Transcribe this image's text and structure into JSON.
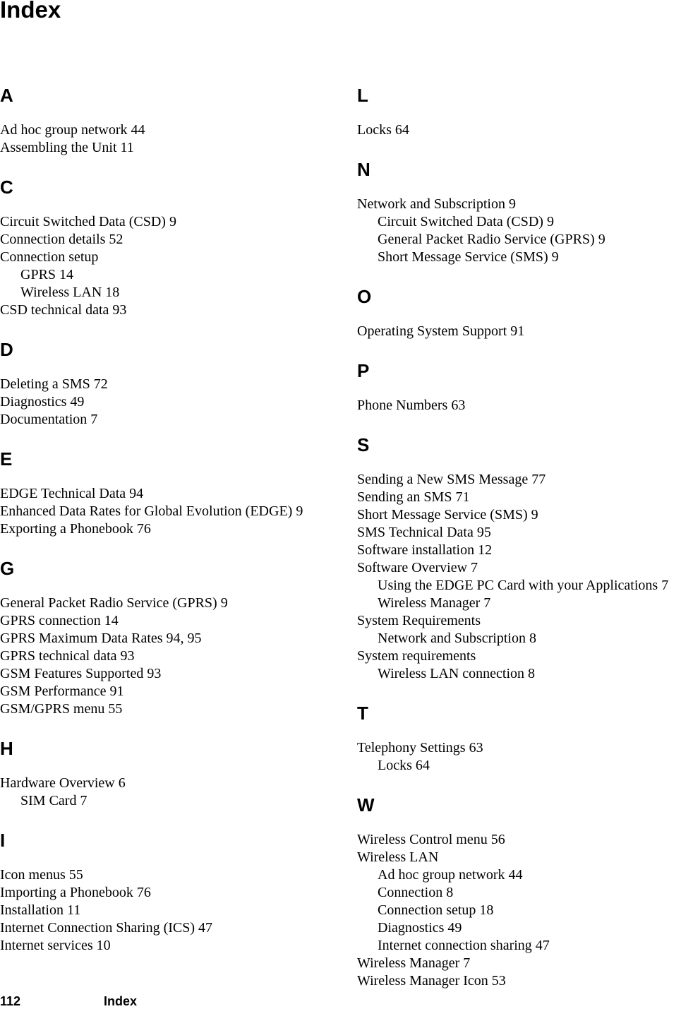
{
  "page": {
    "title": "Index",
    "footer": {
      "page_number": "112",
      "section": "Index"
    }
  },
  "columns": [
    {
      "sections": [
        {
          "letter": "A",
          "entries": [
            {
              "text": "Ad hoc group network 44",
              "level": 0
            },
            {
              "text": "Assembling the Unit 11",
              "level": 0
            }
          ]
        },
        {
          "letter": "C",
          "entries": [
            {
              "text": "Circuit Switched Data (CSD) 9",
              "level": 0
            },
            {
              "text": "Connection details 52",
              "level": 0
            },
            {
              "text": "Connection setup",
              "level": 0
            },
            {
              "text": "GPRS 14",
              "level": 1
            },
            {
              "text": "Wireless LAN 18",
              "level": 1
            },
            {
              "text": "CSD technical data 93",
              "level": 0
            }
          ]
        },
        {
          "letter": "D",
          "entries": [
            {
              "text": "Deleting a SMS 72",
              "level": 0
            },
            {
              "text": "Diagnostics 49",
              "level": 0
            },
            {
              "text": "Documentation 7",
              "level": 0
            }
          ]
        },
        {
          "letter": "E",
          "entries": [
            {
              "text": "EDGE Technical Data 94",
              "level": 0
            },
            {
              "text": "Enhanced Data Rates for Global Evolution (EDGE) 9",
              "level": 0
            },
            {
              "text": "Exporting a Phonebook 76",
              "level": 0
            }
          ]
        },
        {
          "letter": "G",
          "entries": [
            {
              "text": "General Packet Radio Service (GPRS) 9",
              "level": 0
            },
            {
              "text": "GPRS connection 14",
              "level": 0
            },
            {
              "text": "GPRS Maximum Data Rates 94, 95",
              "level": 0
            },
            {
              "text": "GPRS technical data 93",
              "level": 0
            },
            {
              "text": "GSM Features Supported 93",
              "level": 0
            },
            {
              "text": "GSM Performance 91",
              "level": 0
            },
            {
              "text": "GSM/GPRS menu 55",
              "level": 0
            }
          ]
        },
        {
          "letter": "H",
          "entries": [
            {
              "text": "Hardware Overview 6",
              "level": 0
            },
            {
              "text": "SIM Card 7",
              "level": 1
            }
          ]
        },
        {
          "letter": "I",
          "entries": [
            {
              "text": "Icon menus 55",
              "level": 0
            },
            {
              "text": "Importing a Phonebook 76",
              "level": 0
            },
            {
              "text": "Installation 11",
              "level": 0
            },
            {
              "text": "Internet Connection Sharing (ICS) 47",
              "level": 0
            },
            {
              "text": "Internet services 10",
              "level": 0
            }
          ]
        }
      ]
    },
    {
      "sections": [
        {
          "letter": "L",
          "entries": [
            {
              "text": "Locks 64",
              "level": 0
            }
          ]
        },
        {
          "letter": "N",
          "entries": [
            {
              "text": "Network and Subscription 9",
              "level": 0
            },
            {
              "text": "Circuit Switched Data (CSD) 9",
              "level": 1
            },
            {
              "text": "General Packet Radio Service (GPRS) 9",
              "level": 1
            },
            {
              "text": "Short Message Service (SMS) 9",
              "level": 1
            }
          ]
        },
        {
          "letter": "O",
          "entries": [
            {
              "text": "Operating System Support 91",
              "level": 0
            }
          ]
        },
        {
          "letter": "P",
          "entries": [
            {
              "text": "Phone Numbers 63",
              "level": 0
            }
          ]
        },
        {
          "letter": "S",
          "entries": [
            {
              "text": "Sending a New SMS Message 77",
              "level": 0
            },
            {
              "text": "Sending an SMS 71",
              "level": 0
            },
            {
              "text": "Short Message Service (SMS) 9",
              "level": 0
            },
            {
              "text": "SMS Technical Data 95",
              "level": 0
            },
            {
              "text": "Software installation 12",
              "level": 0
            },
            {
              "text": "Software Overview 7",
              "level": 0
            },
            {
              "text": "Using the EDGE PC Card with your Applications 7",
              "level": 1
            },
            {
              "text": "Wireless Manager 7",
              "level": 1
            },
            {
              "text": "System Requirements",
              "level": 0
            },
            {
              "text": "Network and Subscription 8",
              "level": 1
            },
            {
              "text": "System requirements",
              "level": 0
            },
            {
              "text": "Wireless LAN connection 8",
              "level": 1
            }
          ]
        },
        {
          "letter": "T",
          "entries": [
            {
              "text": "Telephony Settings 63",
              "level": 0
            },
            {
              "text": "Locks 64",
              "level": 1
            }
          ]
        },
        {
          "letter": "W",
          "entries": [
            {
              "text": "Wireless Control menu 56",
              "level": 0
            },
            {
              "text": "Wireless LAN",
              "level": 0
            },
            {
              "text": "Ad hoc group network 44",
              "level": 1
            },
            {
              "text": "Connection 8",
              "level": 1
            },
            {
              "text": "Connection setup 18",
              "level": 1
            },
            {
              "text": "Diagnostics 49",
              "level": 1
            },
            {
              "text": "Internet connection sharing 47",
              "level": 1
            },
            {
              "text": "Wireless Manager 7",
              "level": 0
            },
            {
              "text": "Wireless Manager Icon 53",
              "level": 0
            }
          ]
        }
      ]
    }
  ]
}
